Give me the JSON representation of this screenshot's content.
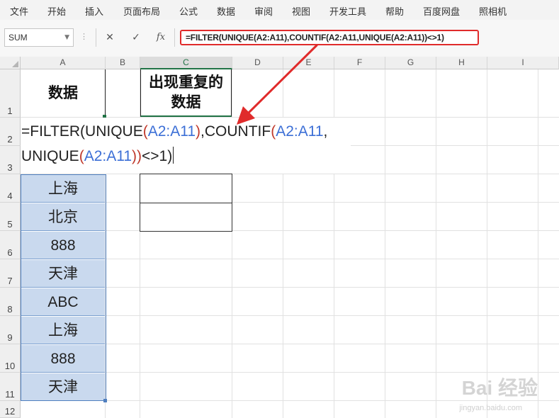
{
  "menu": {
    "items": [
      "文件",
      "开始",
      "插入",
      "页面布局",
      "公式",
      "数据",
      "审阅",
      "视图",
      "开发工具",
      "帮助",
      "百度网盘",
      "照相机"
    ]
  },
  "formula_bar": {
    "name_box": "SUM",
    "cancel_icon": "✕",
    "enter_icon": "✓",
    "fx_label": "fx",
    "formula": "=FILTER(UNIQUE(A2:A11),COUNTIF(A2:A11,UNIQUE(A2:A11))<>1)"
  },
  "columns": [
    "A",
    "B",
    "C",
    "D",
    "E",
    "F",
    "G",
    "H",
    "I"
  ],
  "rows": [
    "1",
    "2",
    "3",
    "4",
    "5",
    "6",
    "7",
    "8",
    "9",
    "10",
    "11",
    "12"
  ],
  "cells": {
    "A1": "数据",
    "C1_line1": "出现重复的",
    "C1_line2": "数据",
    "A_values": [
      "上海",
      "北京",
      "888",
      "天津",
      "ABC",
      "上海",
      "888",
      "天津"
    ]
  },
  "edit": {
    "line1": [
      "=FILTER(UNIQUE",
      "(",
      "A2:A11",
      ")",
      ",COUNTIF",
      "(",
      "A2:A11",
      ","
    ],
    "line2": [
      "UNIQUE",
      "(",
      "A2:A11",
      "))",
      "<>1)"
    ]
  },
  "watermark": {
    "main": "Bai 经验",
    "sub": "jingyan.baidu.com"
  },
  "colors": {
    "accent": "#e02b2b",
    "selected_fill": "#c9d9ee",
    "grid": "#e1e1e1",
    "reference": "#3c6fd6"
  }
}
